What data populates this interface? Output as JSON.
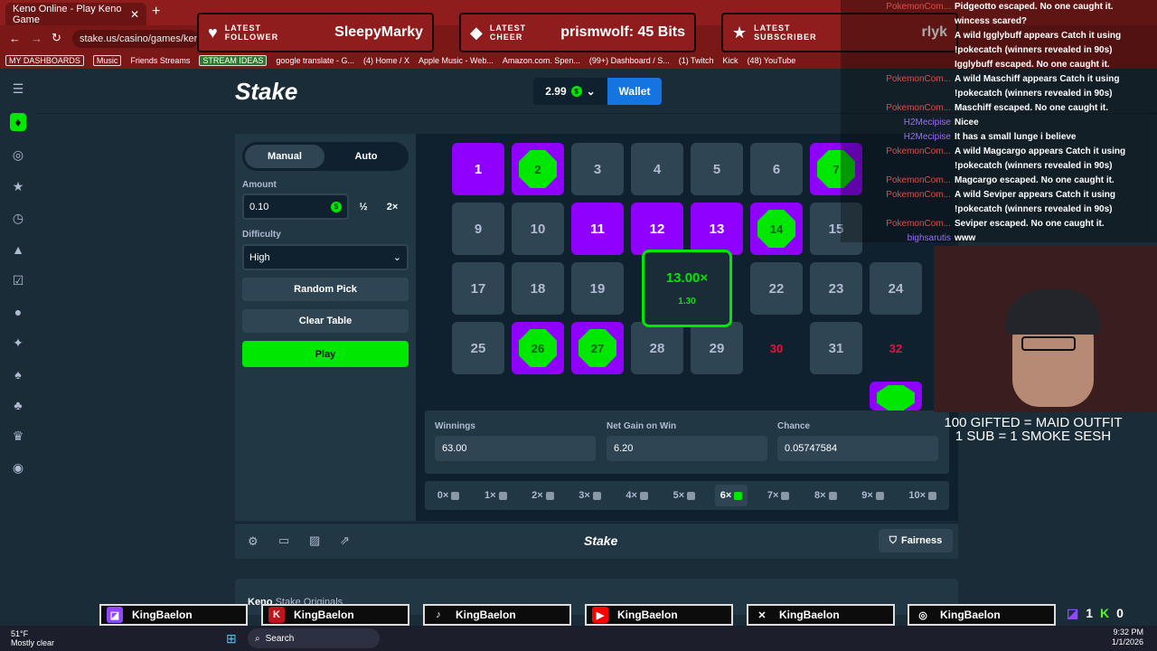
{
  "browser": {
    "tab_title": "Keno Online - Play Keno Game",
    "url": "stake.us/casino/games/keno",
    "bookmarks": [
      "MY DASHBOARDS",
      "Music",
      "Friends Streams",
      "STREAM IDEAS",
      "google translate - G...",
      "(4) Home / X",
      "Apple Music - Web...",
      "Amazon.com. Spen...",
      "(99+) Dashboard / S...",
      "(1) Twitch",
      "Kick",
      "(48) YouTube"
    ]
  },
  "overlay": {
    "follower": {
      "label1": "LATEST",
      "label2": "FOLLOWER",
      "name": "SleepyMarky"
    },
    "cheer": {
      "label1": "LATEST",
      "label2": "CHEER",
      "name": "prismwolf: 45 Bits"
    },
    "subscriber": {
      "label1": "LATEST",
      "label2": "SUBSCRIBER",
      "name": "rlyk"
    },
    "notice_line1": "100 GIFTED = MAID OUTFIT",
    "notice_line2": "1 SUB = 1 SMOKE SESH"
  },
  "chat": [
    {
      "user": "PokemonCom...",
      "color": "r",
      "text": "Pidgeotto escaped. No one caught it."
    },
    {
      "user": "",
      "color": "r",
      "text": "wincess scared?"
    },
    {
      "user": "",
      "color": "r",
      "text": "A wild Igglybuff appears Catch it using"
    },
    {
      "user": "",
      "color": "r",
      "text": "!pokecatch (winners revealed in 90s)"
    },
    {
      "user": "",
      "color": "r",
      "text": "Igglybuff escaped. No one caught it."
    },
    {
      "user": "PokemonCom...",
      "color": "r",
      "text": "A wild Maschiff appears Catch it using"
    },
    {
      "user": "",
      "color": "r",
      "text": "!pokecatch (winners revealed in 90s)"
    },
    {
      "user": "PokemonCom...",
      "color": "r",
      "text": "Maschiff escaped. No one caught it."
    },
    {
      "user": "H2Mecipise",
      "color": "p",
      "text": "Nicee"
    },
    {
      "user": "H2Mecipise",
      "color": "p",
      "text": "It has a small lunge i believe"
    },
    {
      "user": "PokemonCom...",
      "color": "r",
      "text": "A wild Magcargo appears Catch it using"
    },
    {
      "user": "",
      "color": "r",
      "text": "!pokecatch (winners revealed in 90s)"
    },
    {
      "user": "PokemonCom...",
      "color": "r",
      "text": "Magcargo escaped. No one caught it."
    },
    {
      "user": "PokemonCom...",
      "color": "r",
      "text": "A wild Seviper appears Catch it using"
    },
    {
      "user": "",
      "color": "r",
      "text": "!pokecatch (winners revealed in 90s)"
    },
    {
      "user": "PokemonCom...",
      "color": "r",
      "text": "Seviper escaped. No one caught it."
    },
    {
      "user": "bighsarutis",
      "color": "p",
      "text": "www"
    }
  ],
  "stake": {
    "logo": "Stake",
    "balance": "2.99",
    "wallet_label": "Wallet",
    "mode_manual": "Manual",
    "mode_auto": "Auto",
    "amount_label": "Amount",
    "amount_value": "0.10",
    "half": "½",
    "double": "2×",
    "difficulty_label": "Difficulty",
    "difficulty_value": "High",
    "random_pick": "Random Pick",
    "clear_table": "Clear Table",
    "play": "Play",
    "popup_multiplier": "13.00×",
    "popup_amount": "1.30",
    "winnings_label": "Winnings",
    "winnings_value": "63.00",
    "netgain_label": "Net Gain on Win",
    "netgain_value": "6.20",
    "chance_label": "Chance",
    "chance_value": "0.05747584",
    "payouts": [
      "0×",
      "1×",
      "2×",
      "3×",
      "4×",
      "5×",
      "6×",
      "7×",
      "8×",
      "9×",
      "10×"
    ],
    "active_payout": 6,
    "fairness": "Fairness",
    "footer_logo": "Stake",
    "keno_title": "Keno",
    "keno_sub": "Stake Originals"
  },
  "social": [
    {
      "platform": "twitch",
      "name": "KingBaelon",
      "color": "#9146ff"
    },
    {
      "platform": "kick",
      "name": "KingBaelon",
      "color": "#c0141c"
    },
    {
      "platform": "tiktok",
      "name": "KingBaelon",
      "color": "#111111"
    },
    {
      "platform": "youtube",
      "name": "KingBaelon",
      "color": "#ff0000"
    },
    {
      "platform": "x",
      "name": "KingBaelon",
      "color": "#111111"
    },
    {
      "platform": "instagram",
      "name": "KingBaelon",
      "color": "#d6249f"
    }
  ],
  "social_counts": {
    "twitch": "1",
    "kick": "0"
  },
  "taskbar": {
    "weather_temp": "51°F",
    "weather_desc": "Mostly clear",
    "search": "Search",
    "time": "9:32 PM",
    "date": "1/1/2026"
  }
}
